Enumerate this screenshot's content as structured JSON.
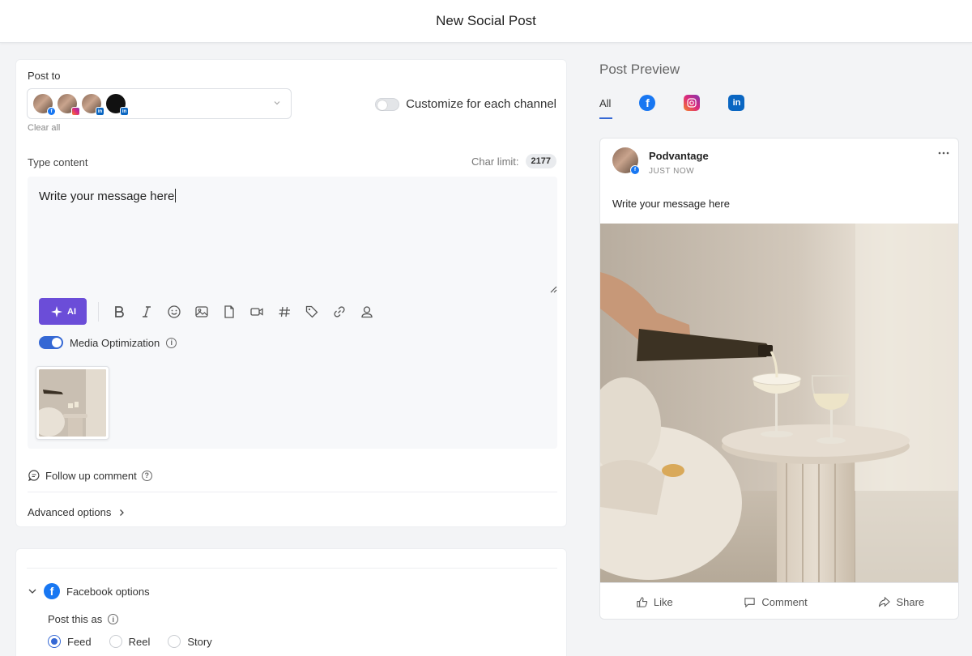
{
  "header": {
    "title": "New Social Post"
  },
  "compose": {
    "post_to_label": "Post to",
    "channels": [
      {
        "name": "avatar-facebook",
        "network": "facebook",
        "avatar": "woman-photo"
      },
      {
        "name": "avatar-instagram",
        "network": "instagram",
        "avatar": "woman-photo"
      },
      {
        "name": "avatar-linkedin",
        "network": "linkedin",
        "avatar": "woman-photo"
      },
      {
        "name": "avatar-linkedin-page",
        "network": "linkedin",
        "avatar": "dark-logo"
      }
    ],
    "clear_all": "Clear all",
    "customize_label": "Customize for each channel",
    "customize_on": false,
    "type_content_label": "Type content",
    "char_limit_label": "Char limit:",
    "char_limit_value": "2177",
    "message": "Write your message here",
    "ai_label": "AI",
    "toolbar_icons": [
      "bold-icon",
      "italic-icon",
      "emoji-icon",
      "image-icon",
      "document-icon",
      "video-icon",
      "hashtag-icon",
      "tag-icon",
      "link-icon",
      "location-icon"
    ],
    "media_optimization_label": "Media Optimization",
    "media_optimization_on": true,
    "follow_up_label": "Follow up comment",
    "advanced_label": "Advanced options"
  },
  "facebook_options": {
    "title": "Facebook options",
    "post_as_label": "Post this as",
    "options": [
      "Feed",
      "Reel",
      "Story"
    ],
    "selected": "Feed"
  },
  "preview": {
    "title": "Post Preview",
    "tab_all": "All",
    "selected_tab": "All",
    "account_name": "Podvantage",
    "time": "JUST NOW",
    "message": "Write your message here",
    "actions": {
      "like": "Like",
      "comment": "Comment",
      "share": "Share"
    }
  },
  "colors": {
    "accent": "#3568d4",
    "ai": "#6b4dd8",
    "facebook": "#1877f2",
    "linkedin": "#0a66c2"
  }
}
